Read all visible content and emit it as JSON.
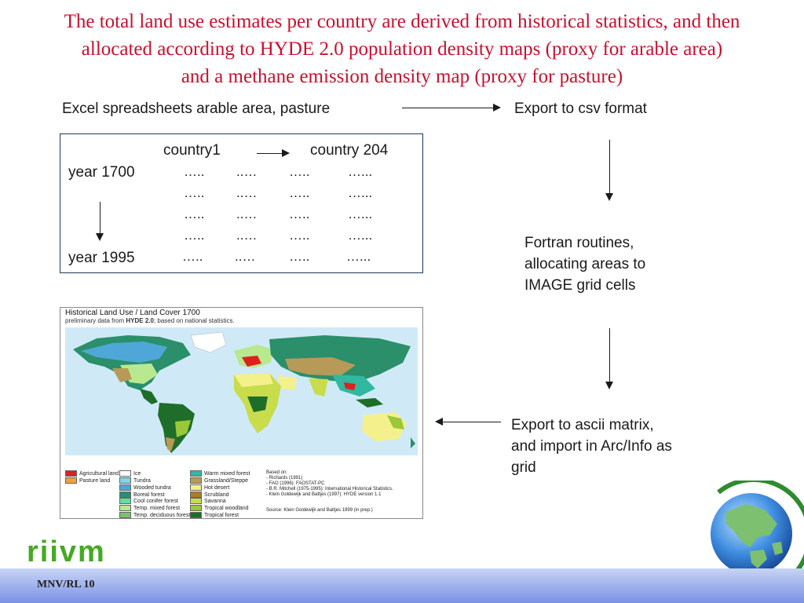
{
  "title": {
    "line1": "The total land use estimates per country are derived from historical statistics, and then",
    "line2": "allocated according to HYDE 2.0 population density maps (proxy for arable area)",
    "line3": "and a methane emission density map (proxy for pasture)"
  },
  "flow": {
    "excel": "Excel spreadsheets arable area, pasture",
    "csv": "Export to csv format",
    "fortran1": "Fortran routines,",
    "fortran2": "allocating areas to",
    "fortran3": "IMAGE grid cells",
    "ascii1": "Export to ascii matrix,",
    "ascii2": "and import in Arc/Info as",
    "ascii3": "grid"
  },
  "table": {
    "country_first": "country1",
    "country_last": "country 204",
    "year_first": "year 1700",
    "year_last": "year 1995",
    "dots": [
      "…..",
      "..…",
      "…..",
      "…..."
    ]
  },
  "map": {
    "title": "Historical Land Use / Land Cover 1700",
    "subtitle_pre": "preliminary data from",
    "subtitle_bold": "HYDE 2.0",
    "subtitle_post": "; based on national statistics.",
    "legend_col1": [
      {
        "label": "Agricultural land",
        "color": "#e02020"
      },
      {
        "label": "Pasture land",
        "color": "#f0a040"
      }
    ],
    "legend_col2": [
      {
        "label": "Ice",
        "color": "#ffffff"
      },
      {
        "label": "Tundra",
        "color": "#7fd4f0"
      },
      {
        "label": "Wooded tundra",
        "color": "#4fa7d8"
      },
      {
        "label": "Boreal forest",
        "color": "#2a8f6a"
      },
      {
        "label": "Cool conifer forest",
        "color": "#5fe0a0"
      },
      {
        "label": "Temp. mixed forest",
        "color": "#b8e890"
      },
      {
        "label": "Temp. deciduous forest",
        "color": "#7cc070"
      }
    ],
    "legend_col3": [
      {
        "label": "Warm mixed forest",
        "color": "#30b8a0"
      },
      {
        "label": "Grassland/Steppe",
        "color": "#b89a58"
      },
      {
        "label": "Hot desert",
        "color": "#f4f08c"
      },
      {
        "label": "Scrubland",
        "color": "#b07a2a"
      },
      {
        "label": "Savanna",
        "color": "#c8dc4c"
      },
      {
        "label": "Tropical woodland",
        "color": "#9ac838"
      },
      {
        "label": "Tropical forest",
        "color": "#1e6e2a"
      }
    ],
    "based_on": [
      "Based on:",
      "- Richards (1991)",
      "- FAO (1996): FAOSTAT-PC",
      "- B.R. Mitchell (1975-1995): International Historical Statistics.",
      "- Klein Goldewijk and Battjes (1997): HYDE version 1.1"
    ],
    "source": "Source: Klein Goldewijk and Battjes 1999 (in prep.)"
  },
  "footer": {
    "label": "MNV/RL 10",
    "logo": "riivm"
  }
}
